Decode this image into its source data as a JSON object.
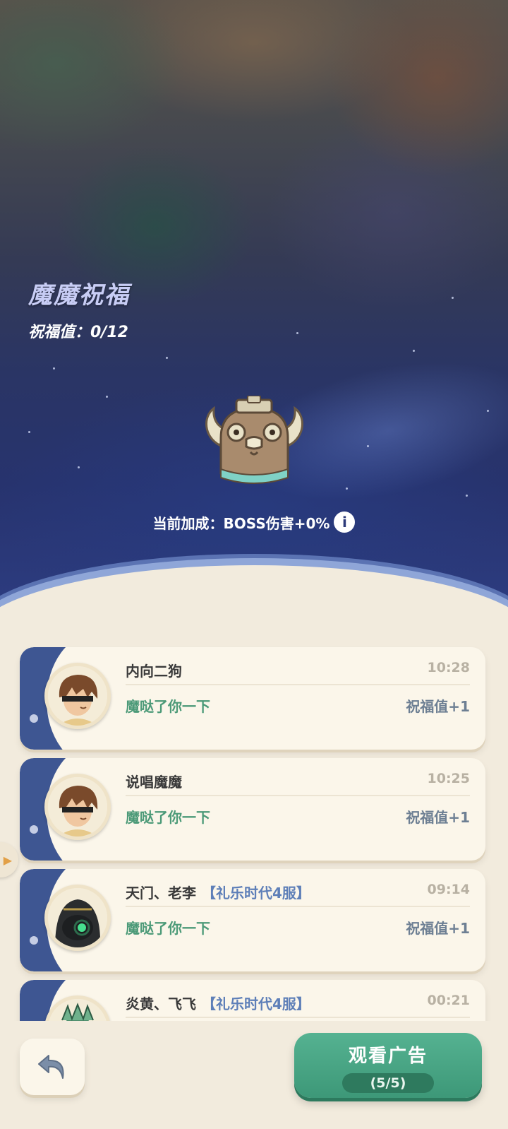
{
  "header": {
    "title": "魔魔祝福",
    "blessing_label": "祝福值：0/12",
    "bonus_text": "当前加成：BOSS伤害+0%",
    "info_icon": "info-icon"
  },
  "messages": [
    {
      "name": "内向二狗",
      "server": "",
      "time": "10:28",
      "action": "魔哒了你一下",
      "gain": "祝福值+1",
      "avatar": "boy-avatar"
    },
    {
      "name": "说唱魔魔",
      "server": "",
      "time": "10:25",
      "action": "魔哒了你一下",
      "gain": "祝福值+1",
      "avatar": "boy-avatar"
    },
    {
      "name": "天门、老李",
      "server": "【礼乐时代4服】",
      "time": "09:14",
      "action": "魔哒了你一下",
      "gain": "祝福值+1",
      "avatar": "robot-avatar"
    },
    {
      "name": "炎黄、飞飞",
      "server": "【礼乐时代4服】",
      "time": "00:21",
      "action": "",
      "gain": "",
      "avatar": "dragon-avatar"
    }
  ],
  "footer": {
    "back_icon": "back-arrow-icon",
    "watch_ad_label": "观看广告",
    "watch_ad_count": "(5/5)"
  },
  "colors": {
    "accent_green": "#4c9a78",
    "server_blue": "#5e7fb8",
    "card_bg": "#fbf6ea"
  }
}
